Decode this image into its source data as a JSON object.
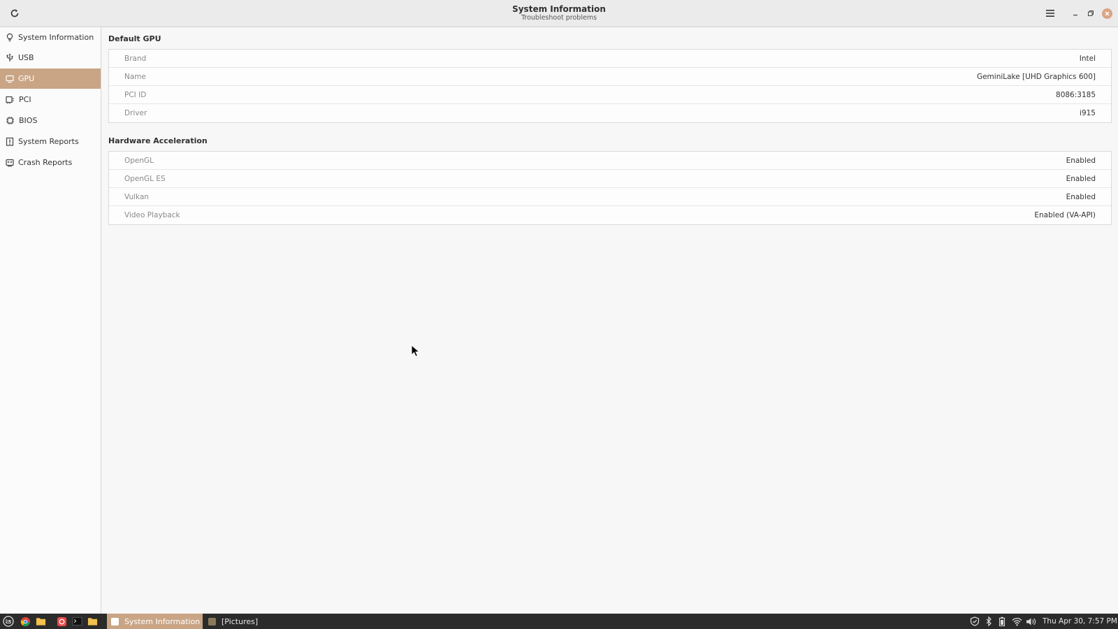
{
  "window": {
    "title": "System Information",
    "subtitle": "Troubleshoot problems"
  },
  "sidebar": {
    "items": [
      {
        "label": "System Information",
        "icon": "lightbulb-icon"
      },
      {
        "label": "USB",
        "icon": "usb-icon"
      },
      {
        "label": "GPU",
        "icon": "monitor-icon",
        "active": true
      },
      {
        "label": "PCI",
        "icon": "pci-card-icon"
      },
      {
        "label": "BIOS",
        "icon": "chip-icon"
      },
      {
        "label": "System Reports",
        "icon": "report-icon"
      },
      {
        "label": "Crash Reports",
        "icon": "crash-report-icon"
      }
    ]
  },
  "sections": {
    "default_gpu": {
      "title": "Default GPU",
      "rows": [
        {
          "key": "Brand",
          "value": "Intel"
        },
        {
          "key": "Name",
          "value": "GeminiLake [UHD Graphics 600]"
        },
        {
          "key": "PCI ID",
          "value": "8086:3185"
        },
        {
          "key": "Driver",
          "value": "i915"
        }
      ]
    },
    "hardware_acceleration": {
      "title": "Hardware Acceleration",
      "rows": [
        {
          "key": "OpenGL",
          "value": "Enabled"
        },
        {
          "key": "OpenGL ES",
          "value": "Enabled"
        },
        {
          "key": "Vulkan",
          "value": "Enabled"
        },
        {
          "key": "Video Playback",
          "value": "Enabled (VA-API)"
        }
      ]
    }
  },
  "taskbar": {
    "tasks": [
      {
        "label": "System Information",
        "active": true
      },
      {
        "label": "[Pictures]",
        "active": false
      }
    ],
    "clock": "Thu Apr 30, 7:57 PM"
  },
  "colors": {
    "accent": "#c9a585",
    "close_button": "#d9a585",
    "taskbar": "#2b2b2b"
  }
}
